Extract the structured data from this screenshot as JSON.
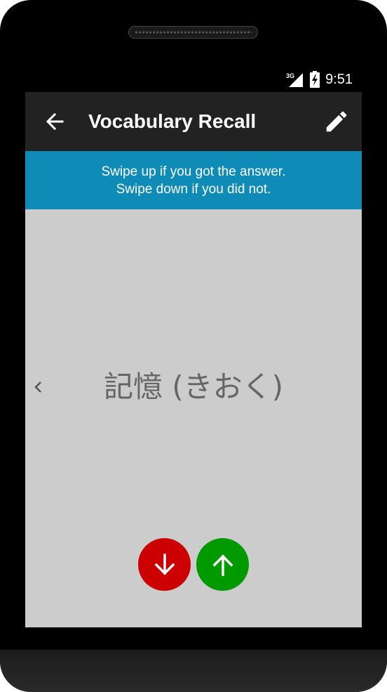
{
  "status_bar": {
    "network_label": "3G",
    "time": "9:51",
    "icons": [
      "signal-icon",
      "battery-charging-icon"
    ]
  },
  "toolbar": {
    "title": "Vocabulary Recall",
    "back_icon": "arrow-left-icon",
    "edit_icon": "pencil-icon"
  },
  "banner": {
    "line1": "Swipe up if you got the answer.",
    "line2": "Swipe down if you did not."
  },
  "card": {
    "word": "記憶 (きおく)",
    "prev_icon": "chevron-left-icon"
  },
  "actions": {
    "down_icon": "arrow-down-icon",
    "up_icon": "arrow-up-icon"
  },
  "colors": {
    "toolbar": "#222222",
    "banner": "#0f8bb8",
    "screen_bg": "#cccccc",
    "word_text": "#666666",
    "down_button": "#cc0000",
    "up_button": "#009900"
  }
}
